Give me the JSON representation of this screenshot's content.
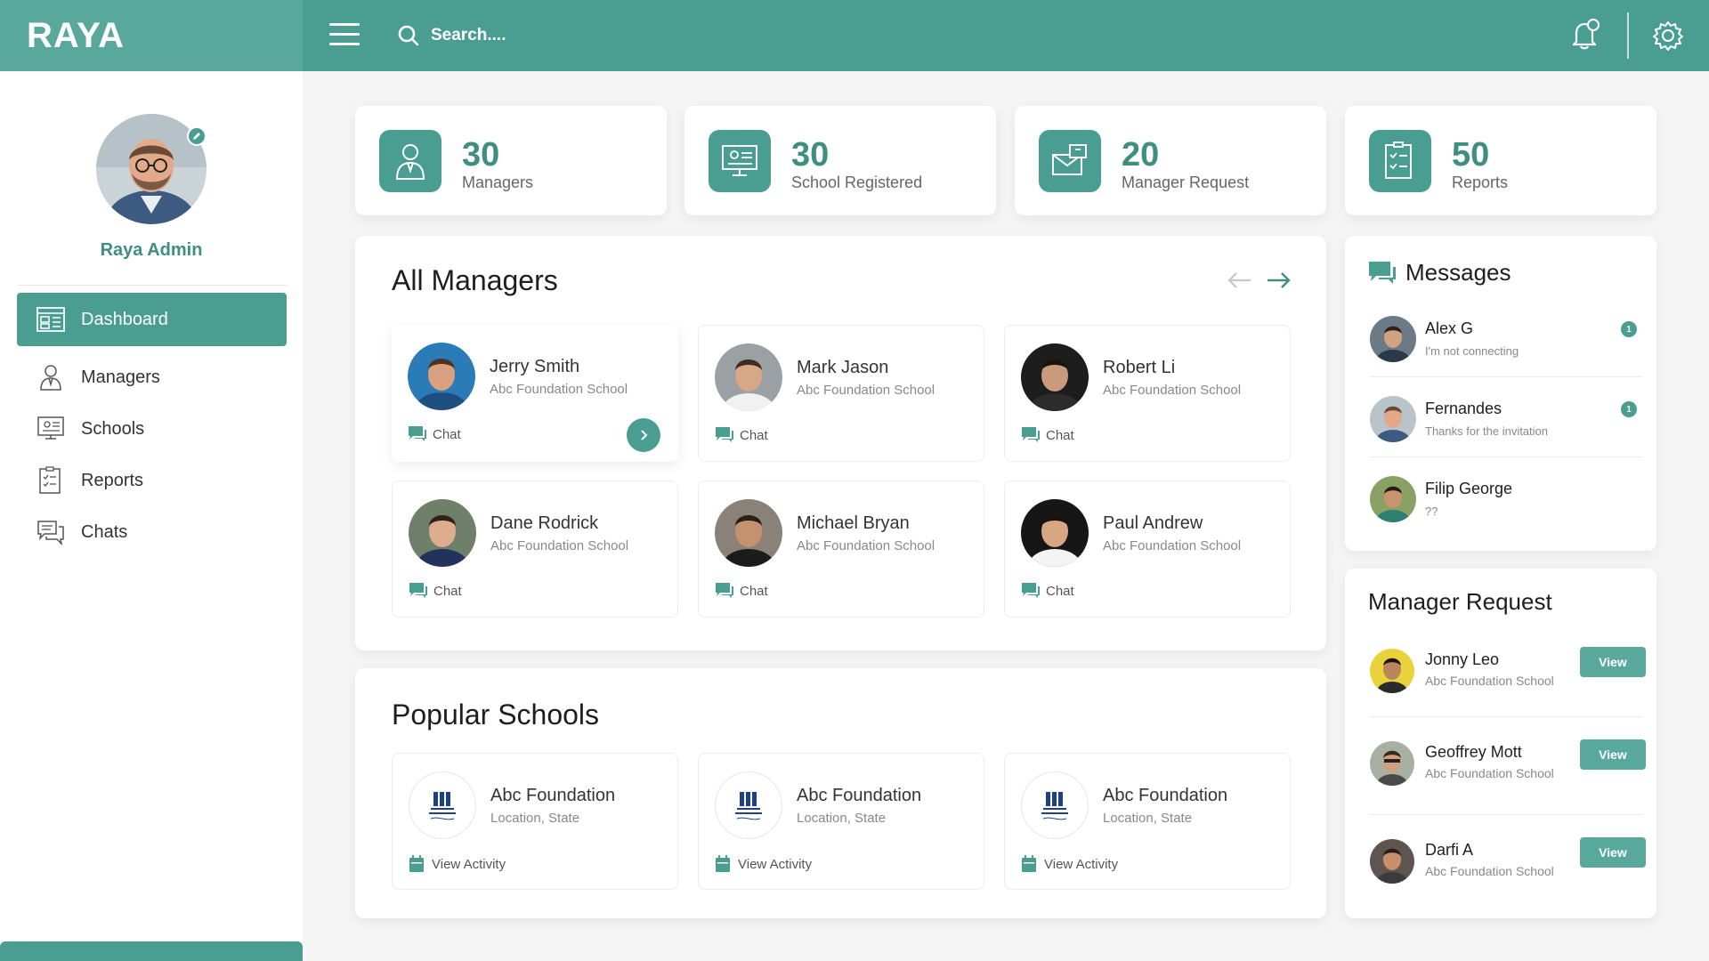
{
  "app": {
    "brand": "RAYA"
  },
  "search": {
    "placeholder": "Search...."
  },
  "icons": {
    "menu": "hamburger-icon",
    "search": "search-icon",
    "notifications": "bell-icon",
    "settings": "gear-icon"
  },
  "colors": {
    "primary": "#4a9d91",
    "brand_panel": "#58a99c",
    "accent_text": "#3e8e82",
    "background": "#f5f5f5"
  },
  "sidebar": {
    "admin_name": "Raya Admin",
    "items": [
      {
        "label": "Dashboard",
        "icon": "dashboard-icon",
        "active": true
      },
      {
        "label": "Managers",
        "icon": "manager-icon",
        "active": false
      },
      {
        "label": "Schools",
        "icon": "school-icon",
        "active": false
      },
      {
        "label": "Reports",
        "icon": "report-icon",
        "active": false
      },
      {
        "label": "Chats",
        "icon": "chat-icon",
        "active": false
      }
    ]
  },
  "stats": [
    {
      "value": "30",
      "label": "Managers",
      "icon": "manager-icon"
    },
    {
      "value": "30",
      "label": "School Registered",
      "icon": "school-icon"
    },
    {
      "value": "20",
      "label": "Manager Request",
      "icon": "request-icon"
    },
    {
      "value": "50",
      "label": "Reports",
      "icon": "report-icon"
    }
  ],
  "managers": {
    "title": "All Managers",
    "chat_label": "Chat",
    "items": [
      {
        "name": "Jerry Smith",
        "school": "Abc Foundation School"
      },
      {
        "name": "Mark Jason",
        "school": "Abc Foundation School"
      },
      {
        "name": "Robert Li",
        "school": "Abc Foundation School"
      },
      {
        "name": "Dane Rodrick",
        "school": "Abc Foundation School"
      },
      {
        "name": "Michael Bryan",
        "school": "Abc Foundation School"
      },
      {
        "name": "Paul Andrew",
        "school": "Abc Foundation School"
      }
    ]
  },
  "schools": {
    "title": "Popular Schools",
    "activity_label": "View Activity",
    "items": [
      {
        "name": "Abc Foundation",
        "location": "Location, State"
      },
      {
        "name": "Abc Foundation",
        "location": "Location, State"
      },
      {
        "name": "Abc Foundation",
        "location": "Location, State"
      }
    ]
  },
  "messages": {
    "title": "Messages",
    "items": [
      {
        "name": "Alex G",
        "text": "I'm not connecting",
        "badge": "1"
      },
      {
        "name": "Fernandes",
        "text": "Thanks for the invitation",
        "badge": "1"
      },
      {
        "name": "Filip George",
        "text": "??",
        "badge": ""
      }
    ]
  },
  "requests": {
    "title": "Manager Request",
    "view_label": "View",
    "items": [
      {
        "name": "Jonny Leo",
        "school": "Abc Foundation School"
      },
      {
        "name": "Geoffrey Mott",
        "school": "Abc Foundation School"
      },
      {
        "name": "Darfi A",
        "school": "Abc Foundation School"
      }
    ]
  }
}
